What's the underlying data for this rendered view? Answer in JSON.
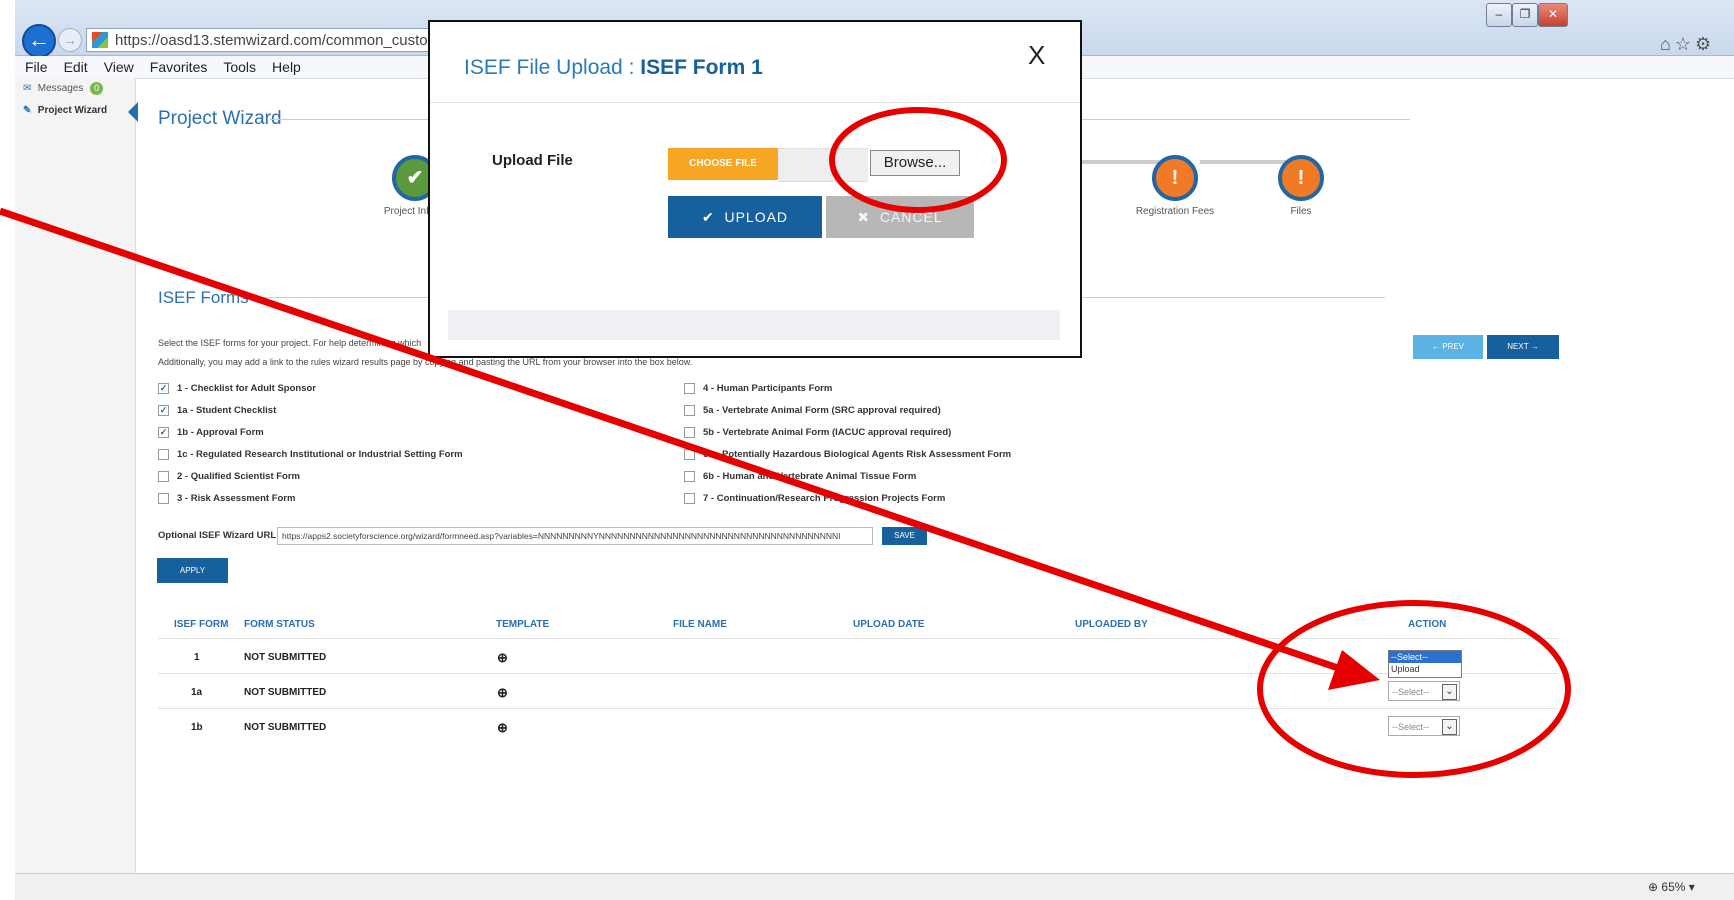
{
  "browser": {
    "url": "https://oasd13.stemwizard.com/common_custom_milestone",
    "menu": [
      "File",
      "Edit",
      "View",
      "Favorites",
      "Tools",
      "Help"
    ],
    "zoom": "65%"
  },
  "sidebar": {
    "items": [
      {
        "label": "Messages",
        "badge": "0"
      },
      {
        "label": "Project Wizard"
      }
    ]
  },
  "wizard": {
    "title": "Project Wizard",
    "steps": [
      {
        "label": "Project Inform",
        "status": "complete",
        "icon": "check-icon",
        "glyph": "✔"
      },
      {
        "label": "Registration Fees",
        "status": "warning",
        "icon": "exclamation-icon",
        "glyph": "!"
      },
      {
        "label": "Files",
        "status": "warning",
        "icon": "exclamation-icon",
        "glyph": "!"
      }
    ]
  },
  "isef_forms": {
    "title": "ISEF Forms",
    "intro_line1": "Select the ISEF forms for your project. For help determining which",
    "intro_line2": "Additionally, you may add a link to the rules wizard results page by copying and pasting the URL from your browser into the box below.",
    "left_forms": [
      {
        "label": "1 - Checklist for Adult Sponsor",
        "checked": true
      },
      {
        "label": "1a - Student Checklist",
        "checked": true
      },
      {
        "label": "1b - Approval Form",
        "checked": true
      },
      {
        "label": "1c - Regulated Research Institutional or Industrial Setting Form",
        "checked": false
      },
      {
        "label": "2 - Qualified Scientist Form",
        "checked": false
      },
      {
        "label": "3 - Risk Assessment Form",
        "checked": false
      }
    ],
    "right_forms": [
      {
        "label": "4 - Human Participants Form",
        "checked": false
      },
      {
        "label": "5a - Vertebrate Animal Form (SRC approval required)",
        "checked": false
      },
      {
        "label": "5b - Vertebrate Animal Form (IACUC approval required)",
        "checked": false
      },
      {
        "label": "6a - Potentially Hazardous Biological Agents Risk Assessment Form",
        "checked": false
      },
      {
        "label": "6b - Human and Vertebrate Animal Tissue Form",
        "checked": false
      },
      {
        "label": "7 - Continuation/Research Progression Projects Form",
        "checked": false
      }
    ],
    "url_label": "Optional ISEF Wizard URL:",
    "url_value": "https://apps2.societyforscience.org/wizard/formneed.asp?variables=NNNNNNNNNYNNNNNNNNNNNNNNNNNNNNNNNNNNNNNNNNNNNNNNNI",
    "save_label": "SAVE",
    "apply_label": "APPLY",
    "prev_label": "← PREV",
    "next_label": "NEXT →"
  },
  "table": {
    "headers": [
      "ISEF FORM",
      "FORM STATUS",
      "TEMPLATE",
      "FILE NAME",
      "UPLOAD DATE",
      "UPLOADED BY",
      "ACTION"
    ],
    "rows": [
      {
        "form": "1",
        "status": "NOT SUBMITTED",
        "template": "⊕",
        "action": "--Select--"
      },
      {
        "form": "1a",
        "status": "NOT SUBMITTED",
        "template": "⊕",
        "action": "--Select--"
      },
      {
        "form": "1b",
        "status": "NOT SUBMITTED",
        "template": "⊕",
        "action": "--Select--"
      }
    ],
    "dropdown_options": [
      "--Select--",
      "Upload"
    ]
  },
  "modal": {
    "title_prefix": "ISEF File Upload : ",
    "title_form": "ISEF Form 1",
    "close_label": "X",
    "upload_label": "Upload File",
    "choose_file_label": "CHOOSE FILE",
    "browse_label": "Browse...",
    "upload_button": "UPLOAD",
    "cancel_button": "CANCEL"
  },
  "colors": {
    "accent": "#2a6fb2",
    "primary_button": "#17609e",
    "choose_file": "#f6a623",
    "step_complete": "#5b9a3c",
    "step_warning": "#f07a25",
    "annotation": "#e60000"
  }
}
